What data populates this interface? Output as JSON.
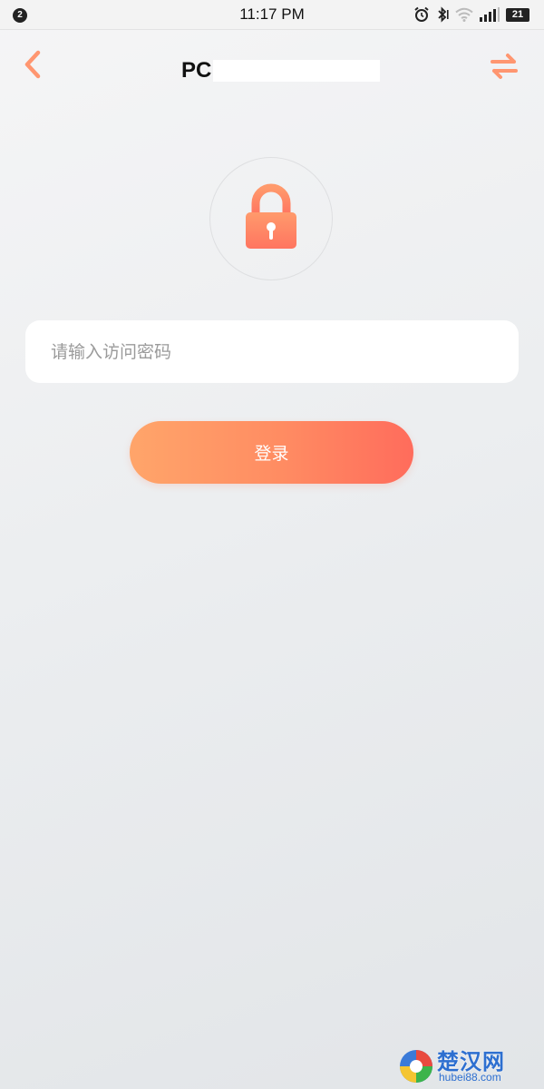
{
  "status_bar": {
    "notification_count": "2",
    "time": "11:17 PM",
    "battery_level": "21",
    "icons": [
      "alarm-icon",
      "bluetooth-icon",
      "wifi-icon",
      "signal-icon",
      "battery-icon"
    ]
  },
  "header": {
    "title": "PC",
    "back_icon": "chevron-left-icon",
    "switch_icon": "swap-arrows-icon"
  },
  "lock": {
    "icon": "lock-icon"
  },
  "password": {
    "placeholder": "请输入访问密码",
    "value": ""
  },
  "login": {
    "label": "登录"
  },
  "watermark": {
    "site_name": "楚汉网",
    "url": "hubei88.com"
  },
  "colors": {
    "accent": "#ff8c62",
    "accent_start": "#ffa56a",
    "accent_end": "#ff6c5c",
    "background": "#eceef0"
  }
}
